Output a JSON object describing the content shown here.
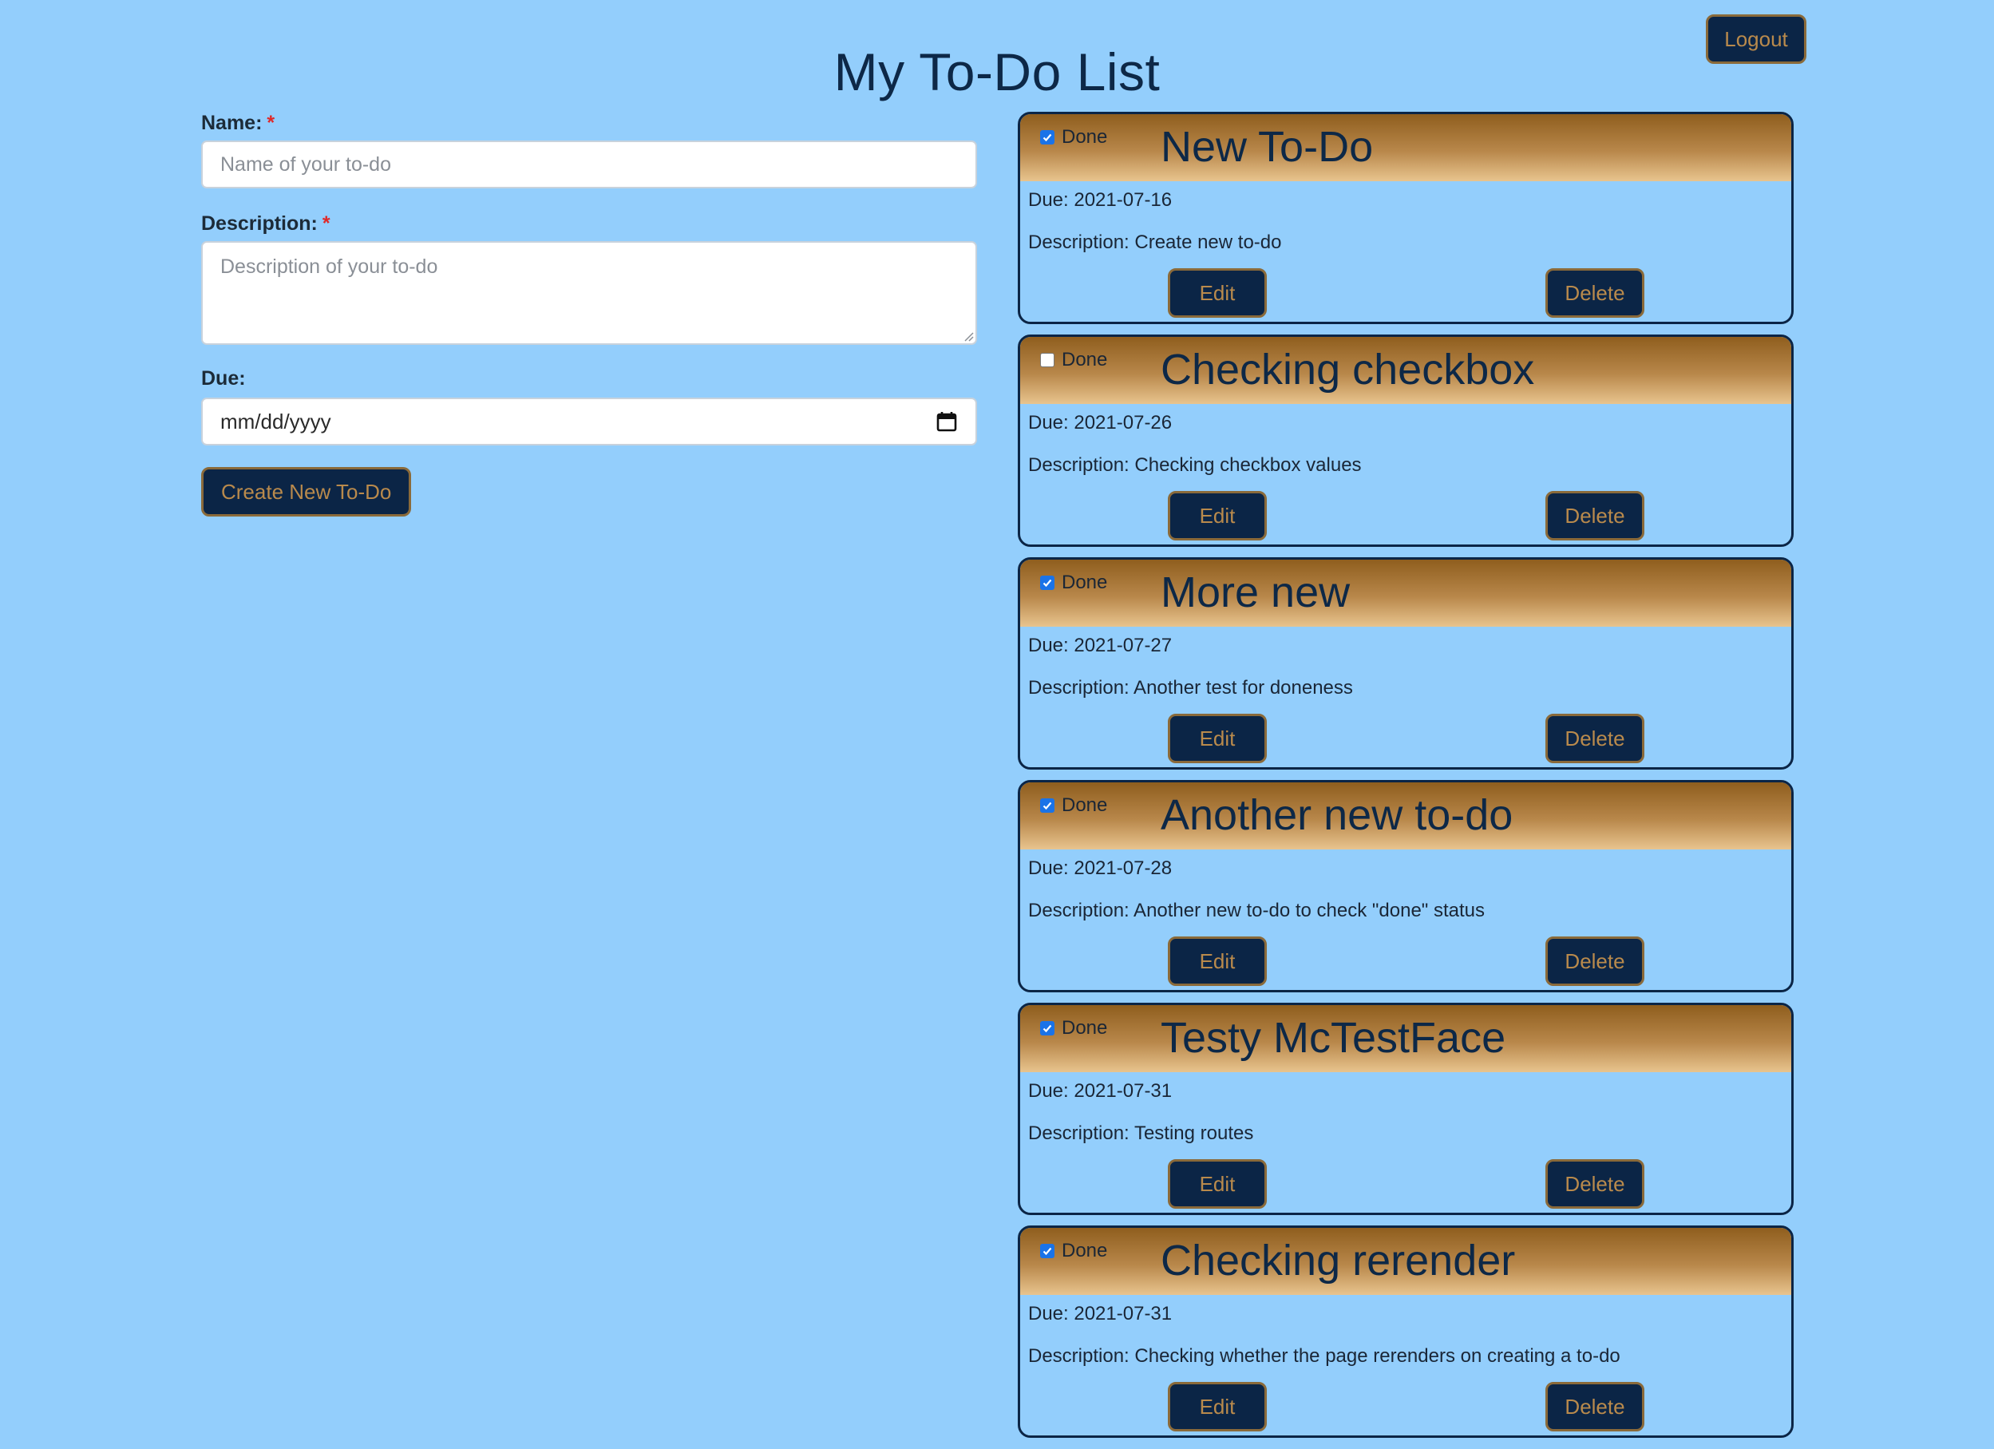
{
  "header": {
    "title": "My To-Do List",
    "logout_label": "Logout"
  },
  "form": {
    "name_label": "Name:",
    "name_required_mark": "*",
    "name_placeholder": "Name of your to-do",
    "name_value": "",
    "description_label": "Description:",
    "description_required_mark": "*",
    "description_placeholder": "Description of your to-do",
    "description_value": "",
    "due_label": "Due:",
    "due_placeholder": "mm/dd/yyyy",
    "create_label": "Create New To-Do"
  },
  "todos": [
    {
      "done": true,
      "done_label": "Done",
      "name": "New To-Do",
      "due": "Due: 2021-07-16",
      "description": "Description: Create new to-do",
      "edit_label": "Edit",
      "delete_label": "Delete"
    },
    {
      "done": false,
      "done_label": "Done",
      "name": "Checking checkbox",
      "due": "Due: 2021-07-26",
      "description": "Description: Checking checkbox values",
      "edit_label": "Edit",
      "delete_label": "Delete"
    },
    {
      "done": true,
      "done_label": "Done",
      "name": "More new",
      "due": "Due: 2021-07-27",
      "description": "Description: Another test for doneness",
      "edit_label": "Edit",
      "delete_label": "Delete"
    },
    {
      "done": true,
      "done_label": "Done",
      "name": "Another new to-do",
      "due": "Due: 2021-07-28",
      "description": "Description: Another new to-do to check \"done\" status",
      "edit_label": "Edit",
      "delete_label": "Delete"
    },
    {
      "done": true,
      "done_label": "Done",
      "name": "Testy McTestFace",
      "due": "Due: 2021-07-31",
      "description": "Description: Testing routes",
      "edit_label": "Edit",
      "delete_label": "Delete"
    },
    {
      "done": true,
      "done_label": "Done",
      "name": "Checking rerender",
      "due": "Due: 2021-07-31",
      "description": "Description: Checking whether the page rerenders on creating a to-do",
      "edit_label": "Edit",
      "delete_label": "Delete"
    }
  ],
  "colors": {
    "background": "#93cefc",
    "button_bg": "#0b2546",
    "button_text": "#b98a4c",
    "header_gradient_top": "#8f5e1e",
    "header_gradient_bottom": "#e8c48e",
    "checkbox_checked": "#1a73e8",
    "required_mark": "#e02828"
  },
  "icons": {
    "date_picker": "calendar-icon",
    "checkbox_checked": "checkmark-icon",
    "textarea_resize": "resize-grip-icon"
  }
}
